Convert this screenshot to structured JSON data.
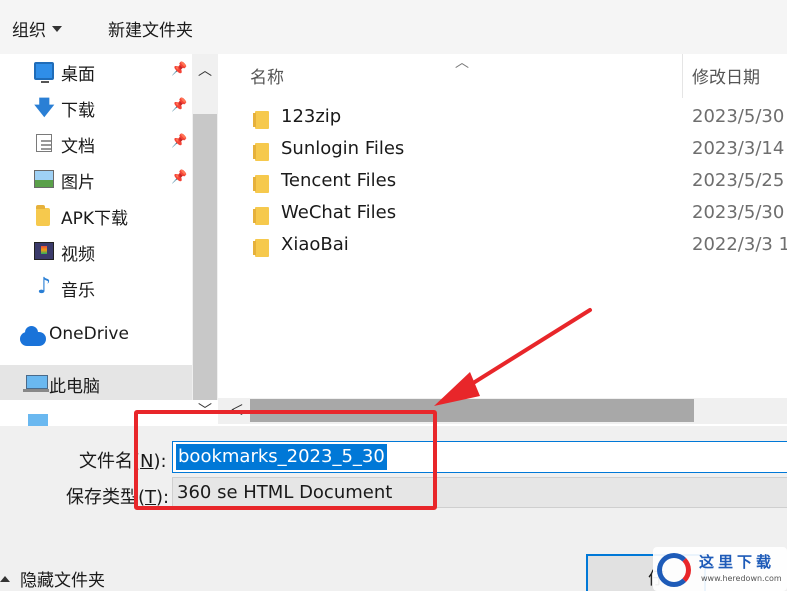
{
  "toolbar": {
    "organize": "组织",
    "new_folder": "新建文件夹"
  },
  "nav": {
    "items": [
      {
        "label": "桌面",
        "icon": "desktop-icon",
        "pinned": true
      },
      {
        "label": "下载",
        "icon": "download-icon",
        "pinned": true
      },
      {
        "label": "文档",
        "icon": "document-icon",
        "pinned": true
      },
      {
        "label": "图片",
        "icon": "pictures-icon",
        "pinned": true
      },
      {
        "label": "APK下载",
        "icon": "folder-icon",
        "pinned": false
      },
      {
        "label": "视频",
        "icon": "video-icon",
        "pinned": false
      },
      {
        "label": "音乐",
        "icon": "music-icon",
        "pinned": false
      },
      {
        "label": "OneDrive",
        "icon": "onedrive-icon",
        "pinned": false
      },
      {
        "label": "此电脑",
        "icon": "this-pc-icon",
        "pinned": false,
        "selected": true
      }
    ]
  },
  "list": {
    "columns": {
      "name": "名称",
      "date": "修改日期"
    },
    "rows": [
      {
        "name": "123zip",
        "date": "2023/5/30"
      },
      {
        "name": "Sunlogin Files",
        "date": "2023/3/14"
      },
      {
        "name": "Tencent Files",
        "date": "2023/5/25"
      },
      {
        "name": "WeChat Files",
        "date": "2023/5/30"
      },
      {
        "name": "XiaoBai",
        "date": "2022/3/3 1"
      }
    ]
  },
  "form": {
    "filename_label": "文件名",
    "filename_key": "N",
    "filename_value": "bookmarks_2023_5_30",
    "type_label": "保存类型",
    "type_key": "T",
    "type_value": "360 se HTML Document",
    "hide_folders": "隐藏文件夹",
    "save_partial": "仔"
  },
  "watermark": {
    "title": "这里下载",
    "url": "www.heredown.com"
  },
  "colors": {
    "accent": "#0078d7",
    "annotation": "#e8262a"
  }
}
